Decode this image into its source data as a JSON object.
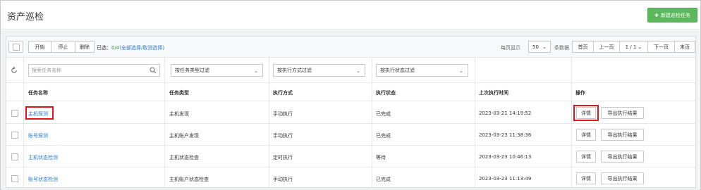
{
  "header": {
    "title": "资产巡检",
    "new_task_label": "新建巡检任务"
  },
  "toolbar": {
    "start_label": "开始",
    "stop_label": "停止",
    "delete_label": "删除",
    "selected_prefix": "已选：",
    "selected_count": "0/4",
    "select_all": "(全部选择/",
    "cancel_select": "取消选择)",
    "per_page_label": "每页显示",
    "per_page_value": "50",
    "per_page_unit": "条数据",
    "first_page": "首页",
    "prev_page": "上一页",
    "page_indicator": "1 / 1",
    "next_page": "下一页",
    "last_page": "末页"
  },
  "filters": {
    "search_placeholder": "搜索任务名称",
    "task_type": "按任务类型过滤",
    "exec_mode": "按执行方式过滤",
    "exec_status": "按执行状态过滤"
  },
  "table": {
    "columns": [
      "任务名称",
      "任务类型",
      "执行方式",
      "执行状态",
      "上次执行时间",
      "操作"
    ],
    "rows": [
      {
        "name": "主机探测",
        "type": "主机发现",
        "mode": "手动执行",
        "status": "已完成",
        "last_run": "2023-03-21 14:19:52"
      },
      {
        "name": "账号探测",
        "type": "主机账户发现",
        "mode": "手动执行",
        "status": "已完成",
        "last_run": "2023-03-23 11:38:36"
      },
      {
        "name": "主机状态检测",
        "type": "主机状态检查",
        "mode": "定时执行",
        "status": "等待",
        "last_run": "2023-03-23 10:46:13"
      },
      {
        "name": "账号状态检测",
        "type": "主机账户状态检查",
        "mode": "手动执行",
        "status": "已完成",
        "last_run": "2023-03-23 11:13:49"
      }
    ],
    "detail_label": "详情",
    "export_label": "导出执行结果"
  },
  "colors": {
    "accent_green": "#5cb85c",
    "link_blue": "#2a7bd3",
    "highlight_red": "#e0141e"
  }
}
